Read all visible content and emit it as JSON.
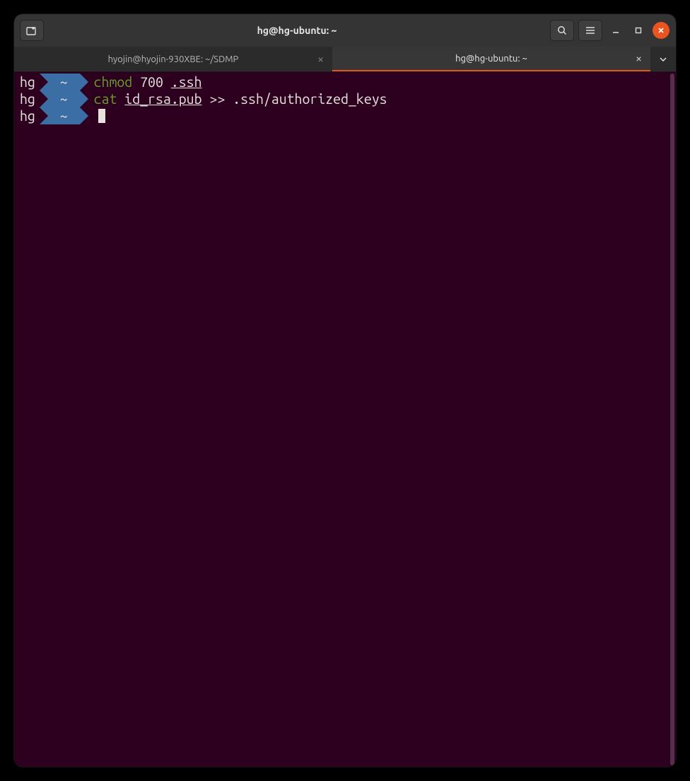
{
  "titlebar": {
    "title": "hg@hg-ubuntu: ~"
  },
  "tabs": [
    {
      "label": "hyojin@hyojin-930XBE: ~/SDMP",
      "active": false
    },
    {
      "label": "hg@hg-ubuntu: ~",
      "active": true
    }
  ],
  "prompt": {
    "user": "hg",
    "path": "~"
  },
  "lines": [
    {
      "cmd": "chmod",
      "args": "700",
      "underlined": ".ssh",
      "tail": ""
    },
    {
      "cmd": "cat",
      "args": "",
      "underlined": "id_rsa.pub",
      "tail": " >> .ssh/authorized_keys"
    },
    {
      "cmd": "",
      "args": "",
      "underlined": "",
      "tail": "",
      "cursor": true
    }
  ],
  "colors": {
    "accent": "#e95420",
    "termbg": "#2c001e",
    "pathbg": "#3a6ea5",
    "cmdgreen": "#6a9a2d"
  }
}
